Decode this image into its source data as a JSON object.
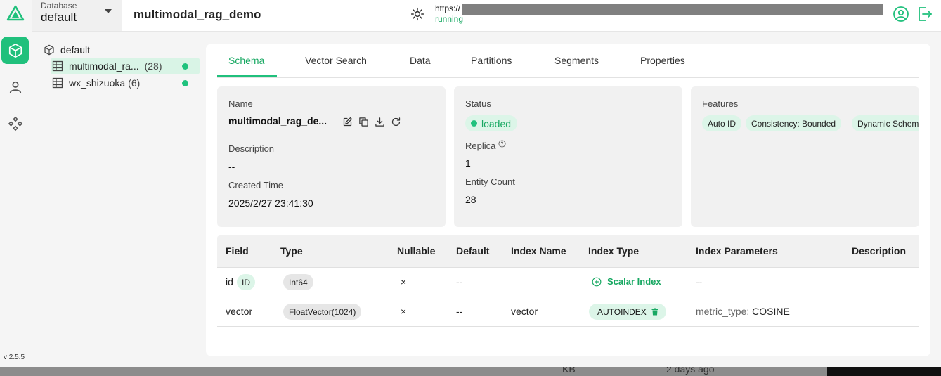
{
  "header": {
    "database_label": "Database",
    "database_value": "default",
    "title": "multimodal_rag_demo",
    "url_prefix": "https://",
    "status": "running"
  },
  "rail": {
    "version": "v 2.5.5",
    "nav": [
      "collections-icon",
      "user-icon",
      "system-icon"
    ]
  },
  "tree": {
    "root": "default",
    "items": [
      {
        "name": "multimodal_ra...",
        "count": "(28)",
        "loaded": true
      },
      {
        "name": "wx_shizuoka",
        "count": "(6)",
        "loaded": true
      }
    ]
  },
  "tabs": [
    "Schema",
    "Vector Search",
    "Data",
    "Partitions",
    "Segments",
    "Properties"
  ],
  "info": {
    "name_label": "Name",
    "name_value": "multimodal_rag_de...",
    "description_label": "Description",
    "description_value": "--",
    "created_label": "Created Time",
    "created_value": "2025/2/27 23:41:30",
    "status_label": "Status",
    "status_value": "loaded",
    "replica_label": "Replica",
    "replica_value": "1",
    "entity_label": "Entity Count",
    "entity_value": "28",
    "features_label": "Features",
    "features": [
      "Auto ID",
      "Consistency: Bounded",
      "Dynamic Schem"
    ]
  },
  "table": {
    "headers": [
      "Field",
      "Type",
      "Nullable",
      "Default",
      "Index Name",
      "Index Type",
      "Index Parameters",
      "Description"
    ],
    "rows": [
      {
        "field": "id",
        "badge": "ID",
        "type": "Int64",
        "nullable": "×",
        "default": "--",
        "index_name": "",
        "index_type": "Scalar Index",
        "index_params": "--",
        "description": ""
      },
      {
        "field": "vector",
        "type": "FloatVector(1024)",
        "nullable": "×",
        "default": "--",
        "index_name": "vector",
        "index_type": "AUTOINDEX",
        "index_params_key": "metric_type:",
        "index_params_value": "COSINE",
        "description": ""
      }
    ]
  },
  "behind": {
    "size": "KB",
    "modified": "2 days ago"
  },
  "colors": {
    "accent": "#20c07c",
    "accent_text": "#17a862",
    "accent_bg": "#dcf5e8"
  }
}
